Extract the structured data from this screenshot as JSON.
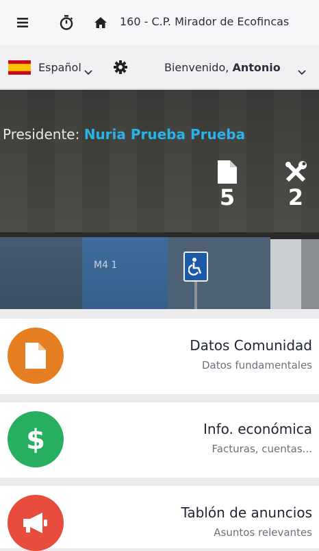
{
  "header": {
    "menu_icon": "hamburger-icon",
    "timer_icon": "stopwatch-icon",
    "home_icon": "home-icon",
    "title": "160 - C.P. Mirador de Ecofincas"
  },
  "toolbar": {
    "language": "Español",
    "settings_icon": "gear-icon",
    "welcome_prefix": "Bienvenido,",
    "user_name": "Antonio"
  },
  "hero": {
    "president_label": "Presidente:",
    "president_name": "Nuria Prueba Prueba",
    "documents_count": "5",
    "incidents_count": "2"
  },
  "cards": [
    {
      "title": "Datos Comunidad",
      "subtitle": "Datos fundamentales",
      "icon": "document-icon",
      "color": "#e67e22"
    },
    {
      "title": "Info. económica",
      "subtitle": "Facturas, cuentas...",
      "icon": "dollar-icon",
      "color": "#27ae60"
    },
    {
      "title": "Tablón de anuncios",
      "subtitle": "Asuntos relevantes",
      "icon": "megaphone-icon",
      "color": "#e74c3c"
    }
  ]
}
